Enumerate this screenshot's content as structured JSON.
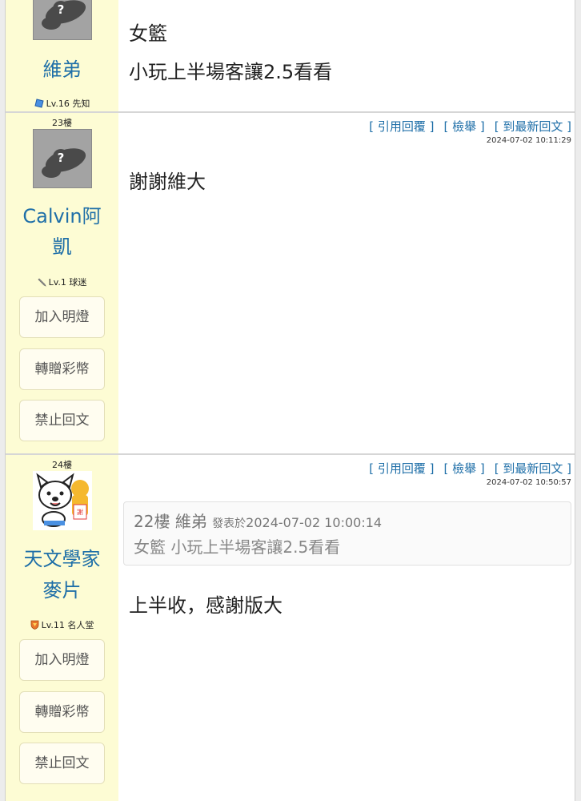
{
  "posts": [
    {
      "user": {
        "name": "維弟",
        "level": "Lv.16 先知",
        "level_icon": "blue-gem-icon"
      },
      "content": [
        "女籃",
        "小玩上半場客讓2.5看看"
      ]
    },
    {
      "floor": "23樓",
      "user": {
        "name_line1": "Calvin阿",
        "name_line2": "凱",
        "level": "Lv.1 球迷",
        "level_icon": "pencil-icon"
      },
      "actions": {
        "quote": "[ 引用回覆 ]",
        "report": "[ 檢舉 ]",
        "latest": "[ 到最新回文 ]"
      },
      "time": "2024-07-02 10:11:29",
      "buttons": {
        "lamp": "加入明燈",
        "gift": "轉贈彩幣",
        "ban": "禁止回文"
      },
      "content": "謝謝維大"
    },
    {
      "floor": "24樓",
      "user": {
        "name_line1": "天文學家",
        "name_line2": "麥片",
        "level": "Lv.11 名人堂",
        "level_icon": "shield-icon"
      },
      "actions": {
        "quote": "[ 引用回覆 ]",
        "report": "[ 檢舉 ]",
        "latest": "[ 到最新回文 ]"
      },
      "time": "2024-07-02 10:50:57",
      "quote": {
        "floor": "22樓",
        "user": "維弟",
        "posted_label": "發表於",
        "posted_time": "2024-07-02 10:00:14",
        "text": "女籃 小玩上半場客讓2.5看看"
      },
      "buttons": {
        "lamp": "加入明燈",
        "gift": "轉贈彩幣",
        "ban": "禁止回文"
      },
      "content": "上半收，感謝版大"
    }
  ],
  "colors": {
    "sidebar": "#fdfcd4",
    "link": "#1f6fa8",
    "username": "#1f6fa8"
  }
}
